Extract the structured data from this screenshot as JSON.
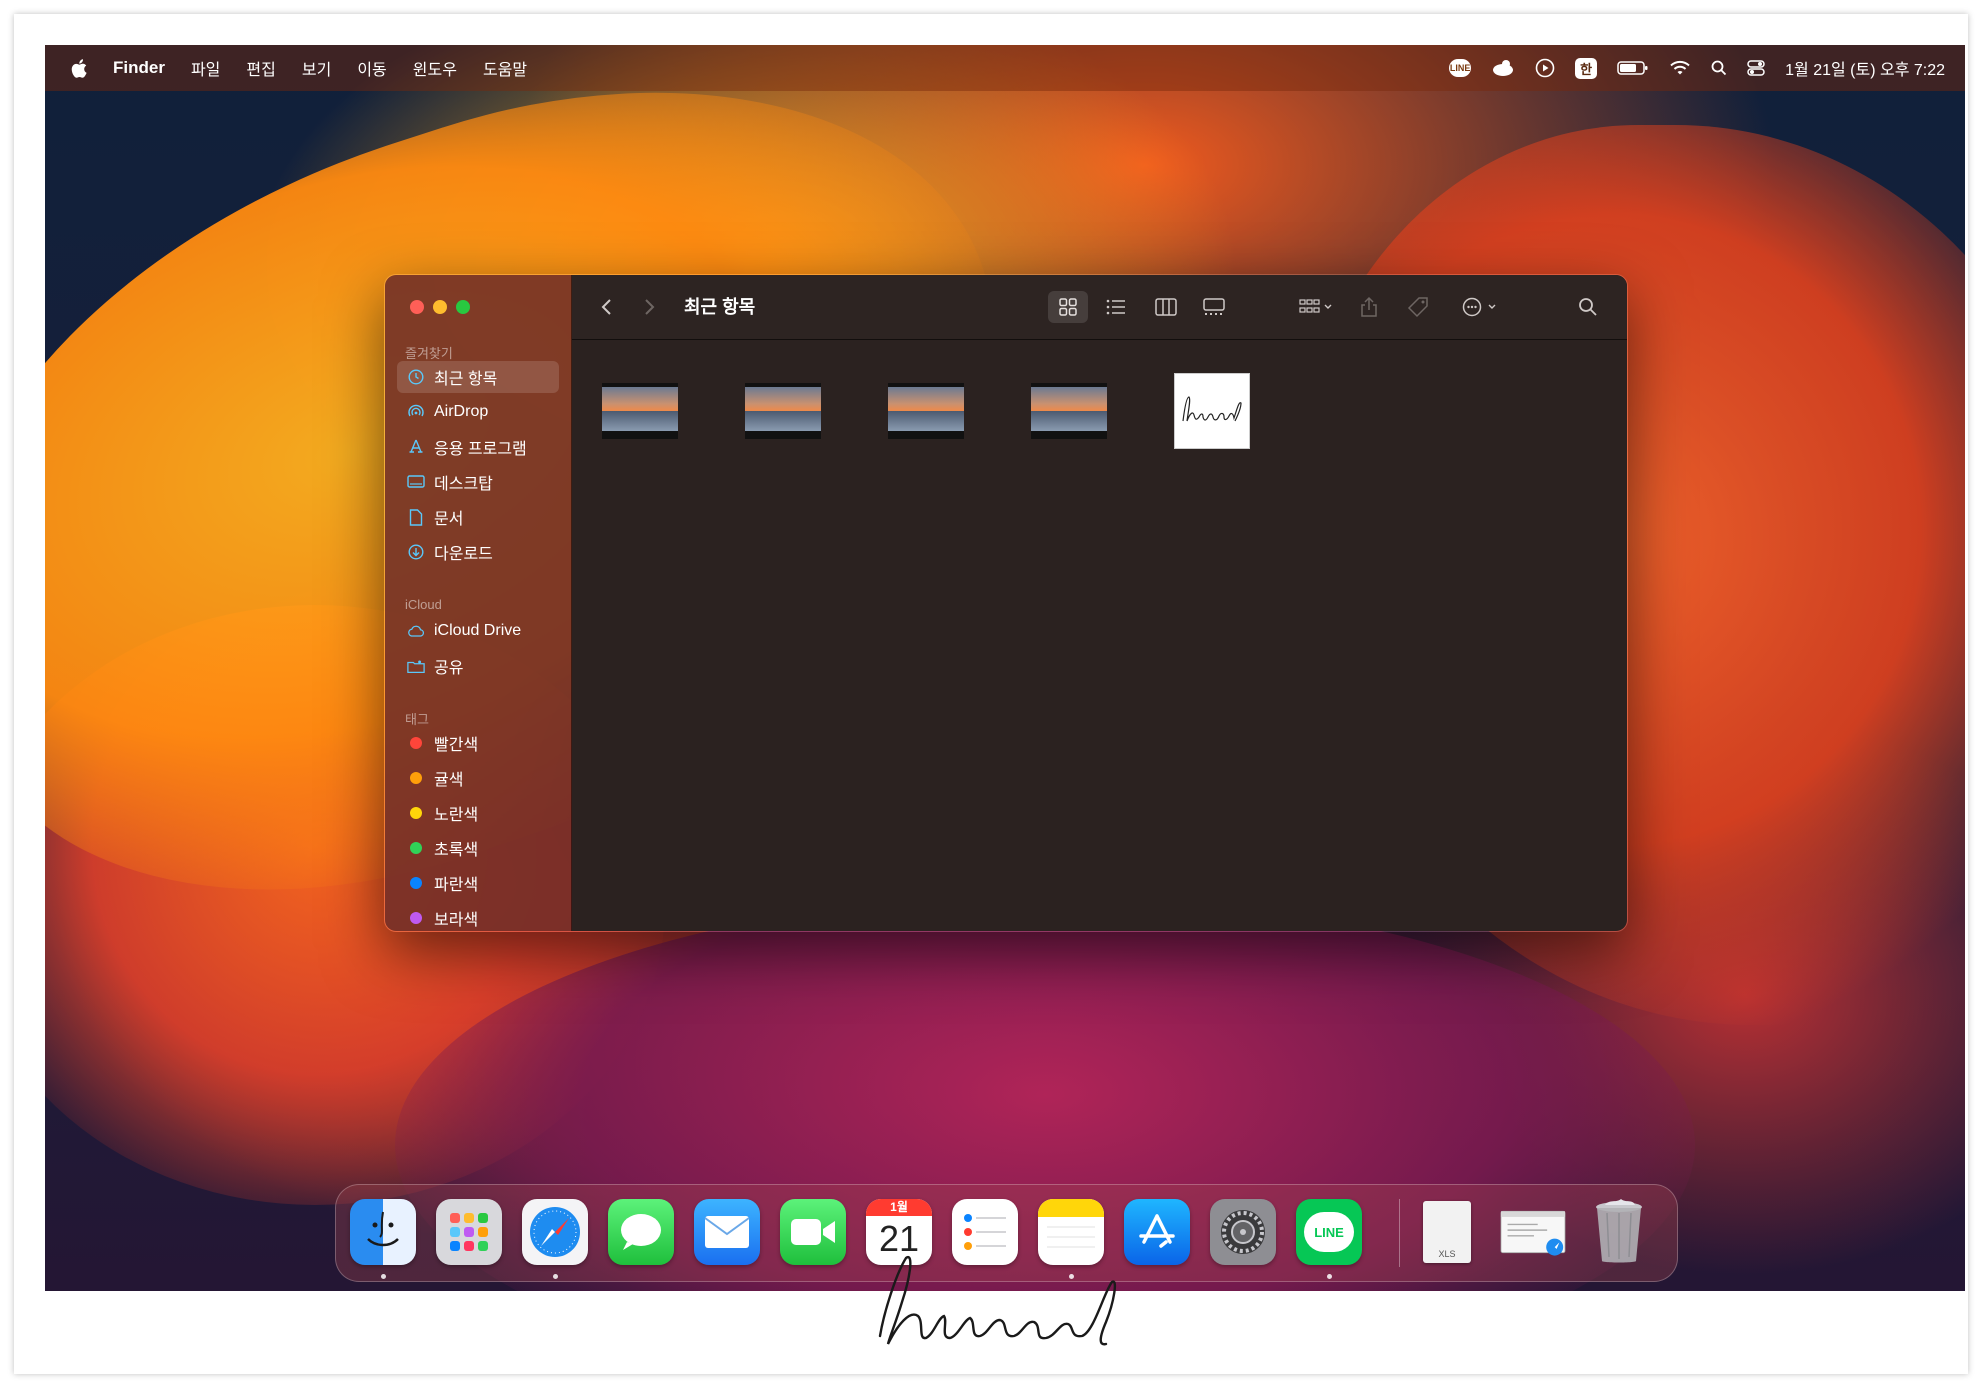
{
  "menubar": {
    "apple_icon": "apple-icon",
    "app_name": "Finder",
    "items": [
      "파일",
      "편집",
      "보기",
      "이동",
      "윈도우",
      "도움말"
    ],
    "status_icons": [
      "line-icon",
      "cloud-icon",
      "play-icon",
      "input-source-icon",
      "battery-icon",
      "wifi-icon",
      "search-icon",
      "control-center-icon"
    ],
    "input_source": "한",
    "line_badge": "LINE",
    "datetime": "1월 21일 (토) 오후 7:22"
  },
  "finder": {
    "title": "최근 항목",
    "sidebar": {
      "favorites_title": "즐겨찾기",
      "favorites": [
        {
          "label": "최근 항목",
          "icon": "clock-icon",
          "active": true
        },
        {
          "label": "AirDrop",
          "icon": "airdrop-icon"
        },
        {
          "label": "응용 프로그램",
          "icon": "applications-icon"
        },
        {
          "label": "데스크탑",
          "icon": "desktop-icon"
        },
        {
          "label": "문서",
          "icon": "document-icon"
        },
        {
          "label": "다운로드",
          "icon": "download-icon"
        }
      ],
      "icloud_title": "iCloud",
      "icloud": [
        {
          "label": "iCloud Drive",
          "icon": "icloud-icon"
        },
        {
          "label": "공유",
          "icon": "shared-folder-icon"
        }
      ],
      "tags_title": "태그",
      "tags": [
        {
          "label": "빨간색",
          "color": "#ff453a"
        },
        {
          "label": "귤색",
          "color": "#ff9f0a"
        },
        {
          "label": "노란색",
          "color": "#ffd60a"
        },
        {
          "label": "초록색",
          "color": "#30d158"
        },
        {
          "label": "파란색",
          "color": "#0a84ff"
        },
        {
          "label": "보라색",
          "color": "#bf5af2"
        }
      ]
    },
    "toolbar": {
      "buttons": [
        "back-icon",
        "forward-icon",
        "icon-view-icon",
        "list-view-icon",
        "column-view-icon",
        "gallery-view-icon",
        "group-icon",
        "share-icon",
        "tag-icon",
        "more-actions-icon",
        "search-icon"
      ]
    },
    "files": [
      {
        "type": "photo",
        "icon": "photo-thumbnail"
      },
      {
        "type": "photo",
        "icon": "photo-thumbnail"
      },
      {
        "type": "photo",
        "icon": "photo-thumbnail"
      },
      {
        "type": "photo",
        "icon": "photo-thumbnail"
      },
      {
        "type": "signature",
        "icon": "signature-thumbnail",
        "text": "hiword"
      }
    ]
  },
  "dock": {
    "apps": [
      {
        "name": "Finder",
        "running": true
      },
      {
        "name": "Launchpad",
        "running": false
      },
      {
        "name": "Safari",
        "running": true
      },
      {
        "name": "Messages",
        "running": false
      },
      {
        "name": "Mail",
        "running": false
      },
      {
        "name": "FaceTime",
        "running": false
      },
      {
        "name": "Calendar",
        "running": false,
        "month": "1월",
        "day": "21"
      },
      {
        "name": "Reminders",
        "running": false
      },
      {
        "name": "Notes",
        "running": true
      },
      {
        "name": "App Store",
        "running": false
      },
      {
        "name": "System Settings",
        "running": false
      },
      {
        "name": "LINE",
        "running": true,
        "label": "LINE"
      }
    ],
    "documents": [
      {
        "name": "XLS document",
        "label": "XLS"
      },
      {
        "name": "Safari window",
        "label": ""
      },
      {
        "name": "Trash",
        "label": ""
      }
    ]
  },
  "watermark": {
    "text": "hiword"
  }
}
